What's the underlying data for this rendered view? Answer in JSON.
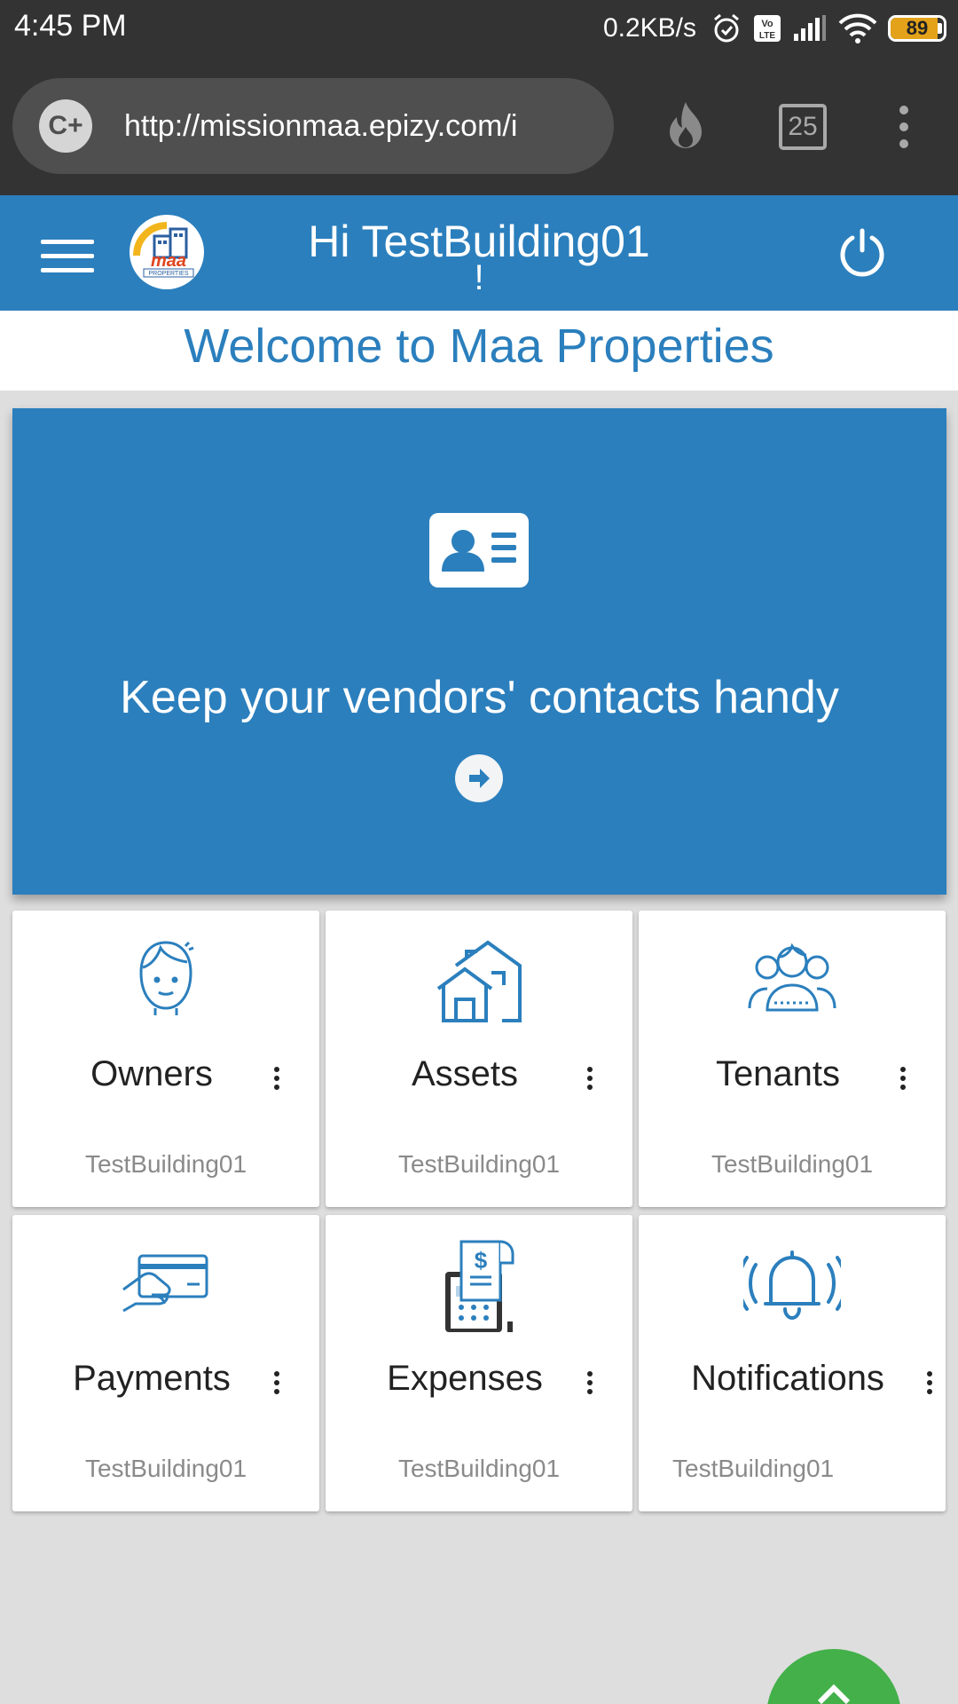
{
  "status_bar": {
    "time": "4:45 PM",
    "net_speed": "0.2KB/s",
    "battery": "89",
    "battery_level": 0.89,
    "icons": [
      "alarm-icon",
      "volte-icon",
      "signal-icon",
      "wifi-icon",
      "battery-icon"
    ]
  },
  "browser": {
    "site_badge": "C+",
    "url": "http://missionmaa.epizy.com/i",
    "tab_count": "25",
    "icons": [
      "flame-icon",
      "tabs-icon",
      "overflow-menu-icon"
    ]
  },
  "header": {
    "greeting": "Hi TestBuilding01",
    "greeting_suffix": "!",
    "logo_text": "maa",
    "logo_sub": "PROPERTIES",
    "icons": [
      "hamburger-icon",
      "power-icon"
    ]
  },
  "welcome": "Welcome to Maa Properties",
  "banner": {
    "text": "Keep your vendors' contacts handy",
    "icons": [
      "contact-card-icon",
      "arrow-right-circle-icon"
    ]
  },
  "cards": [
    {
      "title": "Owners",
      "subtitle": "TestBuilding01",
      "icon": "owner-icon"
    },
    {
      "title": "Assets",
      "subtitle": "TestBuilding01",
      "icon": "house-icon"
    },
    {
      "title": "Tenants",
      "subtitle": "TestBuilding01",
      "icon": "people-icon"
    },
    {
      "title": "Payments",
      "subtitle": "TestBuilding01",
      "icon": "card-payment-icon"
    },
    {
      "title": "Expenses",
      "subtitle": "TestBuilding01",
      "icon": "receipt-machine-icon"
    },
    {
      "title": "Notifications",
      "subtitle": "TestBuilding01",
      "icon": "bell-icon"
    }
  ],
  "colors": {
    "primary": "#2b7fbd",
    "status_bar": "#333333",
    "fab": "#43b049",
    "page_bg": "#dedede"
  }
}
